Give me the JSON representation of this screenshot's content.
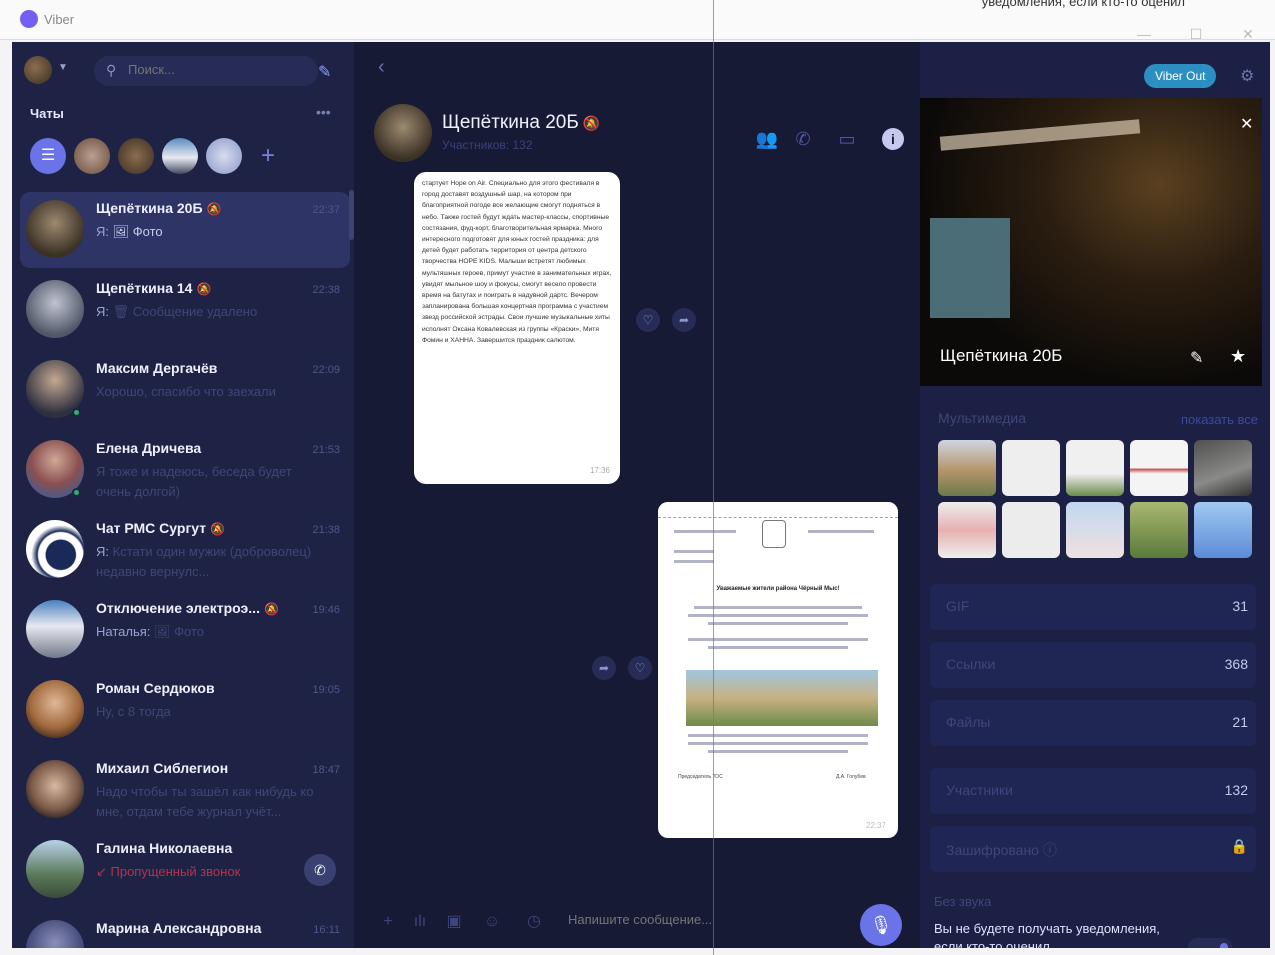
{
  "titlebar": {
    "app_name": "Viber",
    "notice": "уведомления, если кто-то оценил",
    "minimize": "—",
    "maximize": "☐",
    "close": "✕"
  },
  "sidebar": {
    "search_placeholder": "Поиск...",
    "chats_label": "Чаты",
    "more": "•••",
    "items": [
      {
        "name": "Щепёткина 20Б",
        "muted": "🔕",
        "time": "22:37",
        "preview_me": "Я:",
        "preview": "🖼 Фото",
        "active": true
      },
      {
        "name": "Щепёткина 14",
        "muted": "🔕",
        "time": "22:38",
        "preview_me": "Я:",
        "preview": "🗑 Сообщение удалено"
      },
      {
        "name": "Максим Дергачёв",
        "time": "22:09",
        "preview": "Хорошо, спасибо что заехали"
      },
      {
        "name": "Елена Дричева",
        "time": "21:53",
        "preview": "Я тоже и надеюсь, беседа будет очень долгой)"
      },
      {
        "name": "Чат РМС Сургут",
        "muted": "🔕",
        "time": "21:38",
        "preview_me": "Я:",
        "preview": "Кстати один мужик (доброволец) недавно вернулс..."
      },
      {
        "name": "Отключение электроэ...",
        "muted": "🔕",
        "time": "19:46",
        "preview_me": "Наталья:",
        "preview": "🖼 Фото"
      },
      {
        "name": "Роман Сердюков",
        "time": "19:05",
        "preview": "Ну, с 8 тогда"
      },
      {
        "name": "Михаил Сиблегион",
        "time": "18:47",
        "preview": "Надо чтобы ты зашёл как нибудь ко мне, отдам тебе журнал учёт..."
      },
      {
        "name": "Галина Николаевна",
        "time": "",
        "preview": "↙ Пропущенный звонок"
      },
      {
        "name": "Марина Александровна",
        "time": "16:11",
        "preview": ""
      }
    ]
  },
  "chat": {
    "title": "Щепёткина 20Б",
    "muted": "🔕",
    "subtitle": "Участников: 132",
    "message_text": "стартует Hope on Air. Специально для этого фестиваля в город доставят воздушный шар, на котором при благоприятной погоде все желающие смогут подняться в небо. Также гостей будут ждать мастер-классы, спортивные состязания, фуд-корт, благотворительная ярмарка. Много интересного подготовят для юных гостей праздника: для детей будет работать территория от центра детского творчества HOPE KIDS. Малыши встретят любимых мультяшных героев, примут участие в занимательных играх, увидят мыльное шоу и фокусы, смогут весело провести время на батутах и поиграть в надувной дартс. Вечером запланирована большая концертная программа с участием звезд российской эстрады. Свои лучшие музыкальные хиты исполнят Оксана Ковалевская из группы «Краски», Митя Фомин и ХАННА. Завершится праздник салютом.",
    "message_time": "17:36",
    "doc_heading": "Уважаемые жители района Чёрный Мыс!",
    "doc_footer_left": "Председатель ТОС",
    "doc_footer_right": "Д.А. Голубев",
    "doc_time": "22:37",
    "composer_placeholder": "Напишите сообщение..."
  },
  "info": {
    "viber_out": "Viber Out",
    "name": "Щепёткина 20Б",
    "media_label": "Мультимедиа",
    "show_all": "показать все",
    "rows": [
      {
        "label": "GIF",
        "count": "31"
      },
      {
        "label": "Ссылки",
        "count": "368"
      },
      {
        "label": "Файлы",
        "count": "21"
      },
      {
        "label": "Участники",
        "count": "132"
      }
    ],
    "encrypted": "Зашифровано ⓘ",
    "sound_label": "Без звука",
    "sound_desc": "Вы не будете получать уведомления, если кто-то оценил"
  }
}
